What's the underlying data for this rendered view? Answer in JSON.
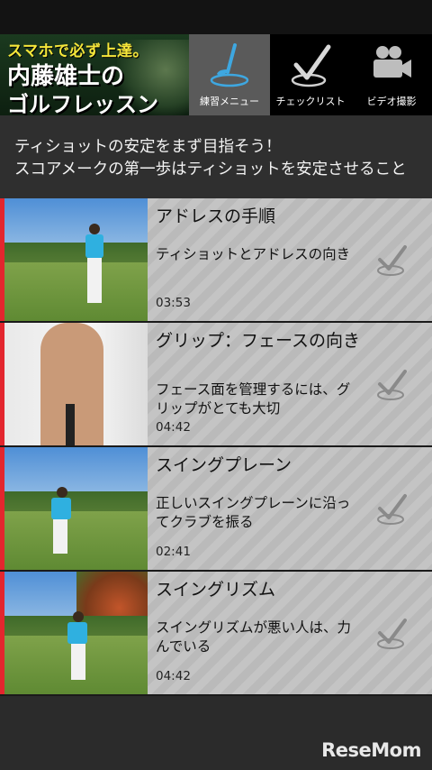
{
  "banner": {
    "line1": "スマホで必ず上達。",
    "line2": "内藤雄士の",
    "line3": "ゴルフレッスン"
  },
  "tabs": [
    {
      "label": "練習メニュー",
      "icon": "golf-club-icon",
      "active": true
    },
    {
      "label": "チェックリスト",
      "icon": "checkmark-icon",
      "active": false
    },
    {
      "label": "ビデオ撮影",
      "icon": "video-camera-icon",
      "active": false
    }
  ],
  "intro": {
    "line1": "ティショットの安定をまず目指そう！",
    "line2": "スコアメークの第一歩はティショットを安定させること"
  },
  "lessons": [
    {
      "title": "アドレスの手順",
      "desc": "ティショットとアドレスの向き",
      "time": "03:53"
    },
    {
      "title": "グリップ：フェースの向き",
      "desc": "フェース面を管理するには、グリップがとても大切",
      "time": "04:42"
    },
    {
      "title": "スイングプレーン",
      "desc": "正しいスイングプレーンに沿ってクラブを振る",
      "time": "02:41"
    },
    {
      "title": "スイングリズム",
      "desc": "スイングリズムが悪い人は、力んでいる",
      "time": "04:42"
    }
  ],
  "watermark": "ReseMom",
  "colors": {
    "accent": "#e3262e",
    "active_tab": "#5a5a5a",
    "list_bg": "#c4c4c4"
  }
}
